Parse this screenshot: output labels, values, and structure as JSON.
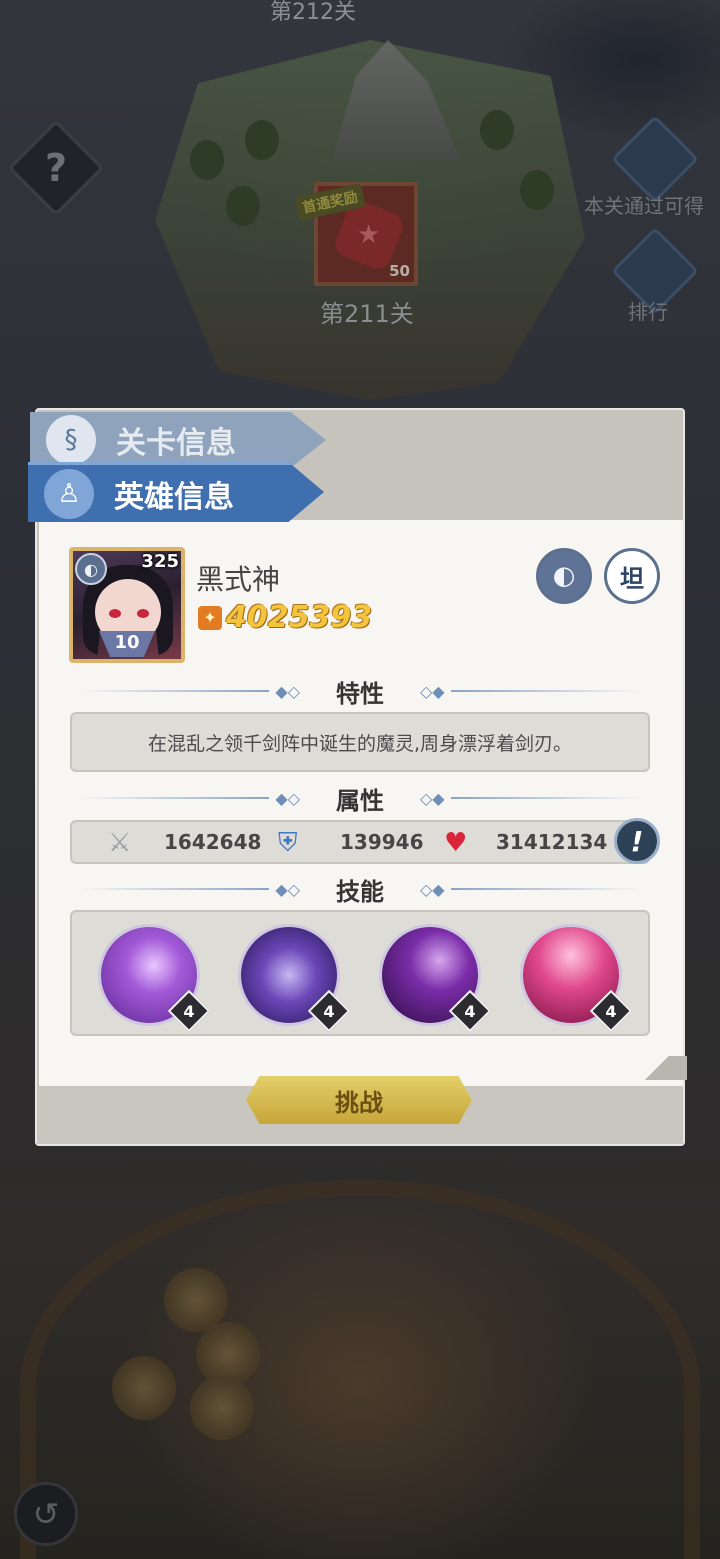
{
  "scene": {
    "top_level_label": "第212关",
    "help_label": "?",
    "reward_banner": "首通奖励",
    "reward_count": "50",
    "level_label": "第211关",
    "side_buttons": [
      {
        "label": "本关通过可得",
        "icon": "diamond-icon"
      },
      {
        "label": "排行",
        "icon": "trophy-icon"
      }
    ]
  },
  "tabs": {
    "stage_info": "关卡信息",
    "hero_info": "英雄信息"
  },
  "hero": {
    "name": "黑式神",
    "level": "325",
    "star_level": "10",
    "power": "4025393",
    "role_badge": "坦"
  },
  "sections": {
    "trait_title": "特性",
    "attributes_title": "属性",
    "skills_title": "技能"
  },
  "trait_text": "在混乱之领千剑阵中诞生的魔灵,周身漂浮着剑刃。",
  "stats": {
    "attack": "1642648",
    "defense": "139946",
    "hp": "31412134"
  },
  "skills": [
    {
      "name": "chain-vortex",
      "level": "4",
      "color": "#8a45c8"
    },
    {
      "name": "floating-body",
      "level": "4",
      "color": "#4b2d8c"
    },
    {
      "name": "dark-orb",
      "level": "4",
      "color": "#5a1f7a"
    },
    {
      "name": "crimson-summon",
      "level": "4",
      "color": "#c0306a"
    }
  ],
  "challenge_button": "挑战",
  "colors": {
    "tab_active": "#3f6fae",
    "power_gold": "#f3c43c",
    "challenge_gold": "#d6b94e"
  }
}
